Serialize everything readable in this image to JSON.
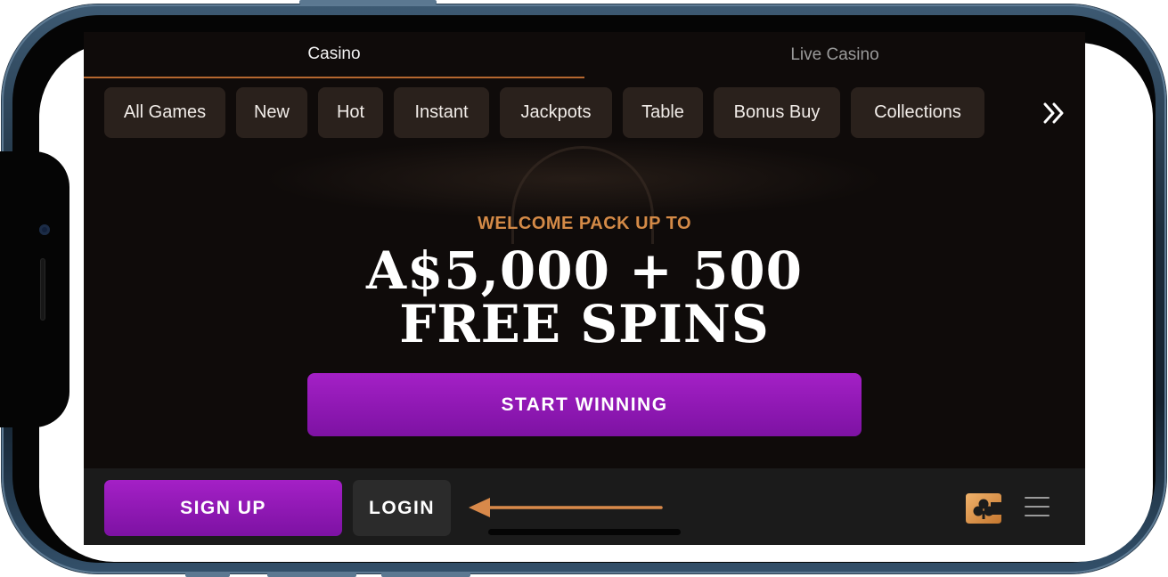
{
  "tabs": [
    {
      "label": "Casino",
      "active": true
    },
    {
      "label": "Live Casino",
      "active": false
    }
  ],
  "categories": [
    "All Games",
    "New",
    "Hot",
    "Instant",
    "Jackpots",
    "Table",
    "Bonus Buy",
    "Collections"
  ],
  "more_icon": "double-chevron-right-icon",
  "hero": {
    "eyebrow": "WELCOME PACK UP TO",
    "line1": "A$5,000 + 500",
    "line2": "FREE SPINS",
    "cta_label": "START WINNING"
  },
  "bottom_bar": {
    "signup_label": "SIGN UP",
    "login_label": "LOGIN",
    "logo_icon": "club-logo-icon",
    "menu_icon": "hamburger-menu-icon"
  },
  "annotation": {
    "icon": "left-arrow-icon"
  },
  "colors": {
    "accent_orange": "#d48a47",
    "cta_purple": "#9b1cc0",
    "background": "#0f0b0a",
    "chip_bg": "#2a211c",
    "bottom_bar_bg": "#1b1b1b",
    "phone_frame": "#1c2d3c"
  }
}
